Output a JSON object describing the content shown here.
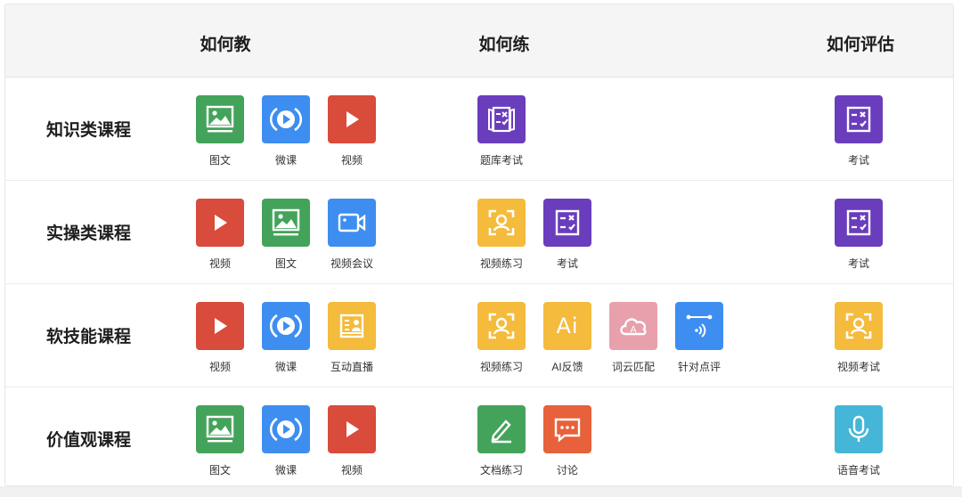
{
  "columns": {
    "teach": "如何教",
    "practice": "如何练",
    "evaluate": "如何评估"
  },
  "colors": {
    "green": "#44a35a",
    "blue": "#3d8ef0",
    "red": "#d94b3b",
    "purple": "#6a3dbd",
    "yellow": "#f4bb3c",
    "pink": "#e8a0ac",
    "teal": "#45b6d8",
    "orange": "#e7613a"
  },
  "rows": [
    {
      "label": "知识类课程",
      "teach": [
        {
          "icon": "image-icon",
          "label": "图文",
          "color": "#44a35a"
        },
        {
          "icon": "play-circle-icon",
          "label": "微课",
          "color": "#3d8ef0"
        },
        {
          "icon": "play-icon",
          "label": "视频",
          "color": "#d94b3b"
        }
      ],
      "practice": [
        {
          "icon": "question-bank-icon",
          "label": "题库考试",
          "color": "#6a3dbd"
        }
      ],
      "evaluate": [
        {
          "icon": "exam-icon",
          "label": "考试",
          "color": "#6a3dbd"
        }
      ]
    },
    {
      "label": "实操类课程",
      "teach": [
        {
          "icon": "play-icon",
          "label": "视频",
          "color": "#d94b3b"
        },
        {
          "icon": "image-icon",
          "label": "图文",
          "color": "#44a35a"
        },
        {
          "icon": "video-camera-icon",
          "label": "视频会议",
          "color": "#3d8ef0"
        }
      ],
      "practice": [
        {
          "icon": "face-frame-icon",
          "label": "视频练习",
          "color": "#f4bb3c"
        },
        {
          "icon": "exam-icon",
          "label": "考试",
          "color": "#6a3dbd"
        }
      ],
      "evaluate": [
        {
          "icon": "exam-icon",
          "label": "考试",
          "color": "#6a3dbd"
        }
      ]
    },
    {
      "label": "软技能课程",
      "teach": [
        {
          "icon": "play-icon",
          "label": "视频",
          "color": "#d94b3b"
        },
        {
          "icon": "play-circle-icon",
          "label": "微课",
          "color": "#3d8ef0"
        },
        {
          "icon": "live-broadcast-icon",
          "label": "互动直播",
          "color": "#f4bb3c"
        }
      ],
      "practice": [
        {
          "icon": "face-frame-icon",
          "label": "视频练习",
          "color": "#f4bb3c"
        },
        {
          "icon": "ai-icon",
          "label": "AI反馈",
          "color": "#f4bb3c",
          "text": "Ai"
        },
        {
          "icon": "word-cloud-icon",
          "label": "词云匹配",
          "color": "#e8a0ac"
        },
        {
          "icon": "audio-review-icon",
          "label": "针对点评",
          "color": "#3d8ef0"
        }
      ],
      "evaluate": [
        {
          "icon": "face-frame-icon",
          "label": "视频考试",
          "color": "#f4bb3c"
        }
      ]
    },
    {
      "label": "价值观课程",
      "teach": [
        {
          "icon": "image-icon",
          "label": "图文",
          "color": "#44a35a"
        },
        {
          "icon": "play-circle-icon",
          "label": "微课",
          "color": "#3d8ef0"
        },
        {
          "icon": "play-icon",
          "label": "视频",
          "color": "#d94b3b"
        }
      ],
      "practice": [
        {
          "icon": "pencil-icon",
          "label": "文档练习",
          "color": "#44a35a"
        },
        {
          "icon": "chat-icon",
          "label": "讨论",
          "color": "#e7613a"
        }
      ],
      "evaluate": [
        {
          "icon": "microphone-icon",
          "label": "语音考试",
          "color": "#45b6d8"
        }
      ]
    }
  ]
}
